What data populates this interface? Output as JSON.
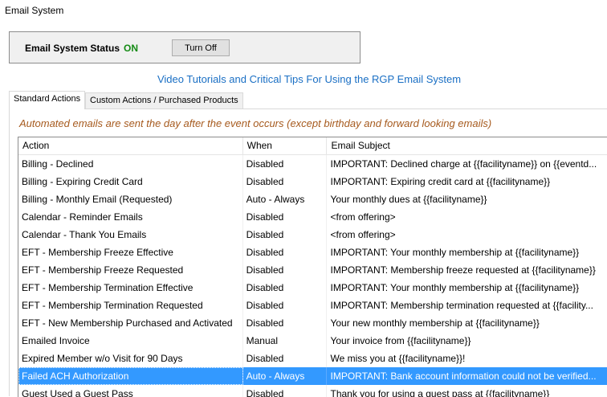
{
  "window": {
    "title": "Email System"
  },
  "status": {
    "label": "Email System Status",
    "value": "ON",
    "value_color": "#138a13",
    "toggle_label": "Turn Off"
  },
  "tutorial_link": "Video Tutorials and Critical Tips For Using the RGP Email System",
  "tabs": [
    {
      "label": "Standard Actions",
      "active": true
    },
    {
      "label": "Custom Actions / Purchased Products",
      "active": false
    }
  ],
  "notice": "Automated emails are sent the day after the event occurs (except birthday and forward looking emails)",
  "grid": {
    "columns": [
      "Action",
      "When",
      "Email Subject"
    ],
    "rows": [
      {
        "action": "Billing - Declined",
        "when": "Disabled",
        "subject": "IMPORTANT: Declined charge at {{facilityname}} on {{eventd..."
      },
      {
        "action": "Billing - Expiring Credit Card",
        "when": "Disabled",
        "subject": "IMPORTANT: Expiring credit card at {{facilityname}}"
      },
      {
        "action": "Billing - Monthly Email (Requested)",
        "when": "Auto - Always",
        "subject": "Your monthly dues at {{facilityname}}"
      },
      {
        "action": "Calendar - Reminder Emails",
        "when": "Disabled",
        "subject": "<from offering>"
      },
      {
        "action": "Calendar - Thank You Emails",
        "when": "Disabled",
        "subject": "<from offering>"
      },
      {
        "action": "EFT - Membership Freeze Effective",
        "when": "Disabled",
        "subject": "IMPORTANT: Your monthly membership at {{facilityname}}"
      },
      {
        "action": "EFT - Membership Freeze Requested",
        "when": "Disabled",
        "subject": "IMPORTANT: Membership freeze requested at {{facilityname}}"
      },
      {
        "action": "EFT - Membership Termination Effective",
        "when": "Disabled",
        "subject": "IMPORTANT: Your monthly membership at {{facilityname}}"
      },
      {
        "action": "EFT - Membership Termination Requested",
        "when": "Disabled",
        "subject": "IMPORTANT: Membership termination requested at {{facility..."
      },
      {
        "action": "EFT - New Membership Purchased and Activated",
        "when": "Disabled",
        "subject": "Your new monthly membership at {{facilityname}}"
      },
      {
        "action": "Emailed Invoice",
        "when": "Manual",
        "subject": "Your invoice from {{facilityname}}"
      },
      {
        "action": "Expired Member w/o Visit for 90 Days",
        "when": "Disabled",
        "subject": "We miss you at {{facilityname}}!"
      },
      {
        "action": "Failed ACH Authorization",
        "when": "Auto - Always",
        "subject": "IMPORTANT: Bank account information could not be verified...",
        "selected": true
      },
      {
        "action": "Guest Used a Guest Pass",
        "when": "Disabled",
        "subject": "Thank you for using a guest pass at {{facilityname}}"
      }
    ],
    "selection_color": "#3399ff"
  }
}
